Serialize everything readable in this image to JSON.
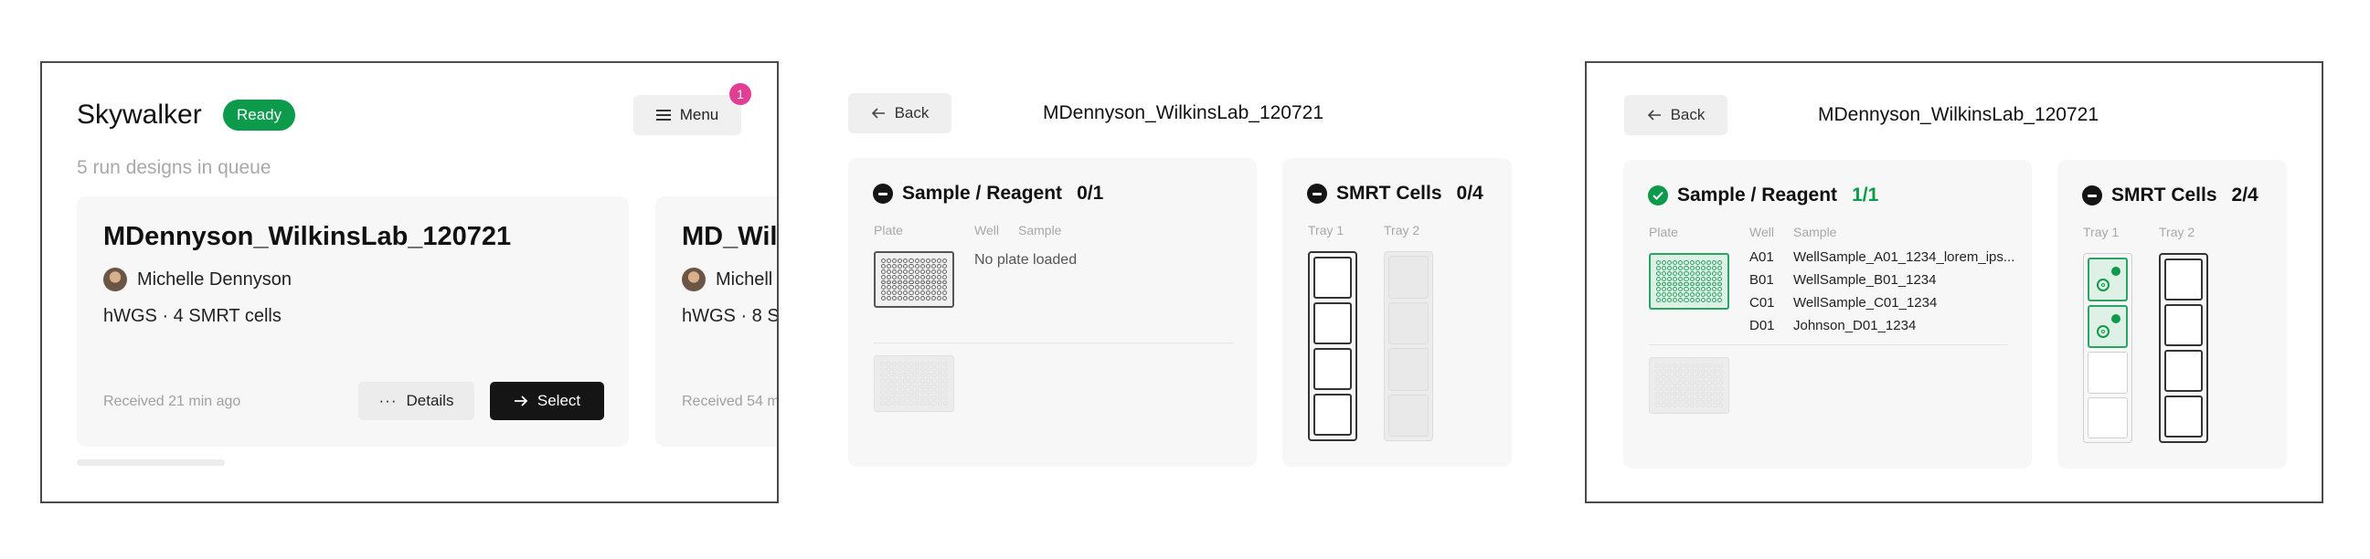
{
  "screen_list": {
    "app_title": "Skywalker",
    "status_badge": "Ready",
    "menu_label": "Menu",
    "notification_count": "1",
    "queue_text": "5 run designs in queue",
    "runs": [
      {
        "name": "MDennyson_WilkinsLab_120721",
        "owner": "Michelle Dennyson",
        "meta": "hWGS · 4 SMRT cells",
        "received": "Received 21 min ago",
        "details_label": "Details",
        "select_label": "Select"
      },
      {
        "name": "MD_Wil",
        "owner": "Michell",
        "meta": "hWGS · 8 S",
        "received": "Received 54 m"
      }
    ]
  },
  "screen_empty": {
    "back_label": "Back",
    "title": "MDennyson_WilkinsLab_120721",
    "sample_panel": {
      "title": "Sample / Reagent",
      "count": "0/1",
      "col_plate": "Plate",
      "col_well": "Well",
      "col_sample": "Sample",
      "empty_text": "No plate loaded"
    },
    "smrt_panel": {
      "title": "SMRT Cells",
      "count": "0/4",
      "tray1": "Tray 1",
      "tray2": "Tray 2"
    }
  },
  "screen_loaded": {
    "back_label": "Back",
    "title": "MDennyson_WilkinsLab_120721",
    "sample_panel": {
      "title": "Sample / Reagent",
      "count": "1/1",
      "col_plate": "Plate",
      "col_well": "Well",
      "col_sample": "Sample",
      "rows": [
        {
          "well": "A01",
          "sample": "WellSample_A01_1234_lorem_ips..."
        },
        {
          "well": "B01",
          "sample": "WellSample_B01_1234"
        },
        {
          "well": "C01",
          "sample": "WellSample_C01_1234"
        },
        {
          "well": "D01",
          "sample": "Johnson_D01_1234"
        }
      ]
    },
    "smrt_panel": {
      "title": "SMRT Cells",
      "count": "2/4",
      "tray1": "Tray 1",
      "tray2": "Tray 2"
    }
  },
  "colors": {
    "accent_green": "#0c9b4b",
    "notification_pink": "#e23e96",
    "primary_button": "#151515"
  }
}
